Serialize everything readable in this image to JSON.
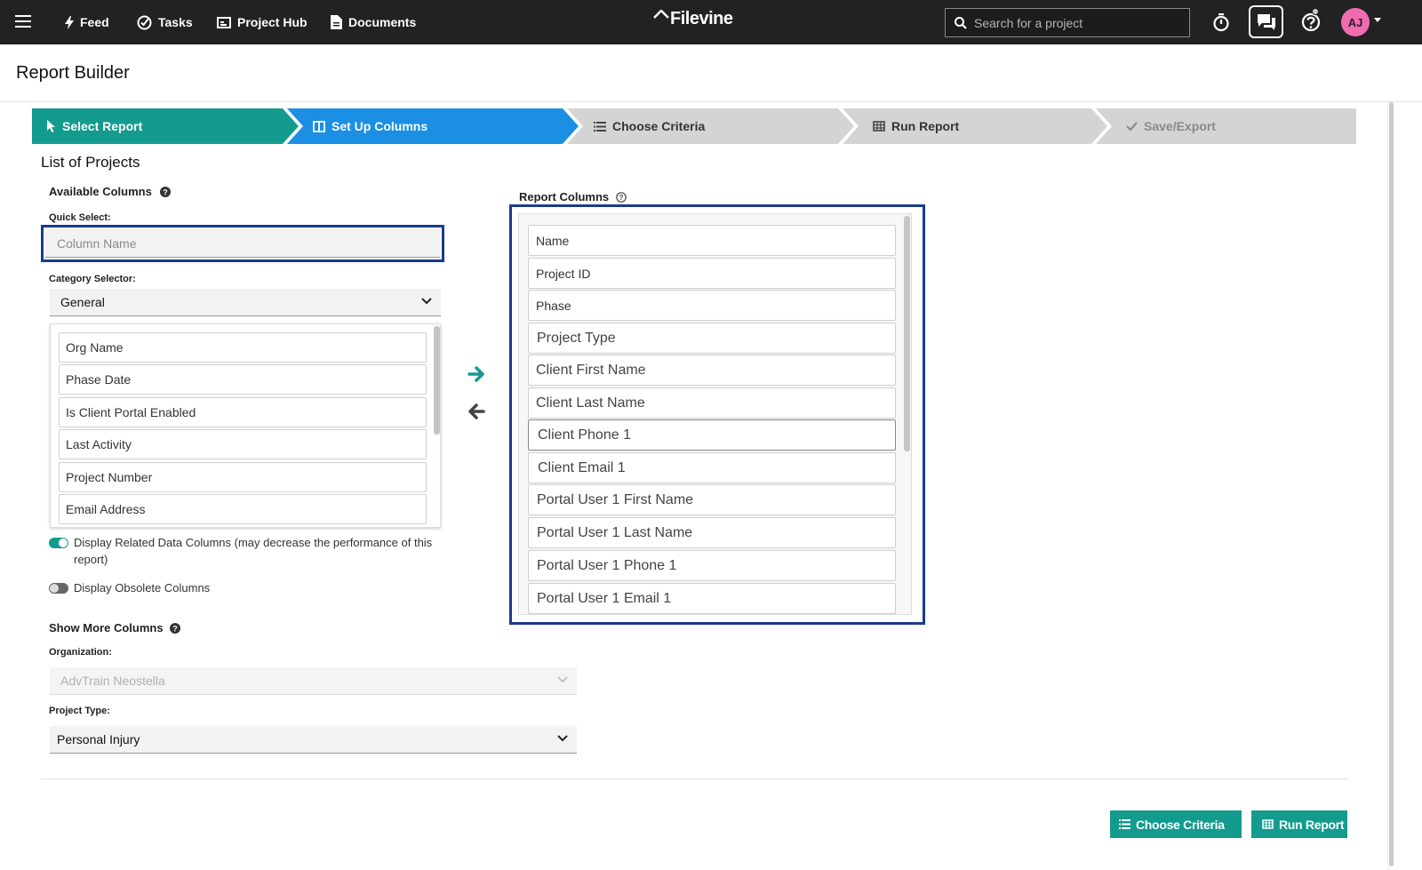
{
  "nav": {
    "items": [
      "Feed",
      "Tasks",
      "Project Hub",
      "Documents"
    ],
    "logo": "Filevine",
    "search_placeholder": "Search for a project",
    "avatar_initials": "AJ"
  },
  "page": {
    "title": "Report Builder",
    "section_title": "List of Projects"
  },
  "steps": [
    {
      "label": "Select Report",
      "state": "complete",
      "color": "#139b8e"
    },
    {
      "label": "Set Up Columns",
      "state": "active",
      "color": "#1a8fe3"
    },
    {
      "label": "Choose Criteria",
      "state": "upcoming"
    },
    {
      "label": "Run Report",
      "state": "upcoming"
    },
    {
      "label": "Save/Export",
      "state": "disabled"
    }
  ],
  "available": {
    "title": "Available Columns",
    "quick_select_label": "Quick Select:",
    "quick_select_placeholder": "Column Name",
    "category_label": "Category Selector:",
    "category_value": "General",
    "items": [
      "Org Name",
      "Phase Date",
      "Is Client Portal Enabled",
      "Last Activity",
      "Project Number",
      "Email Address"
    ],
    "toggle_related": {
      "label": "Display Related Data Columns (may decrease the performance of this report)",
      "on": true
    },
    "toggle_obsolete": {
      "label": "Display Obsolete Columns",
      "on": false
    }
  },
  "more": {
    "title": "Show More Columns",
    "org_label": "Organization:",
    "org_value": "AdvTrain Neostella",
    "type_label": "Project Type:",
    "type_value": "Personal Injury"
  },
  "report_columns": {
    "title": "Report Columns",
    "items": [
      "Name",
      "Project ID",
      "Phase",
      "Project Type",
      "Client First Name",
      "Client Last Name",
      "Client Phone 1",
      "Client Email 1",
      "Portal User 1 First Name",
      "Portal User 1 Last Name",
      "Portal User 1 Phone 1",
      "Portal User 1 Email 1"
    ]
  },
  "actions": {
    "choose_criteria": "Choose Criteria",
    "run_report": "Run Report"
  },
  "colors": {
    "teal": "#139b8e",
    "blue": "#1a8fe3",
    "focus_border": "#1a3a8c",
    "avatar": "#f06cb1"
  }
}
